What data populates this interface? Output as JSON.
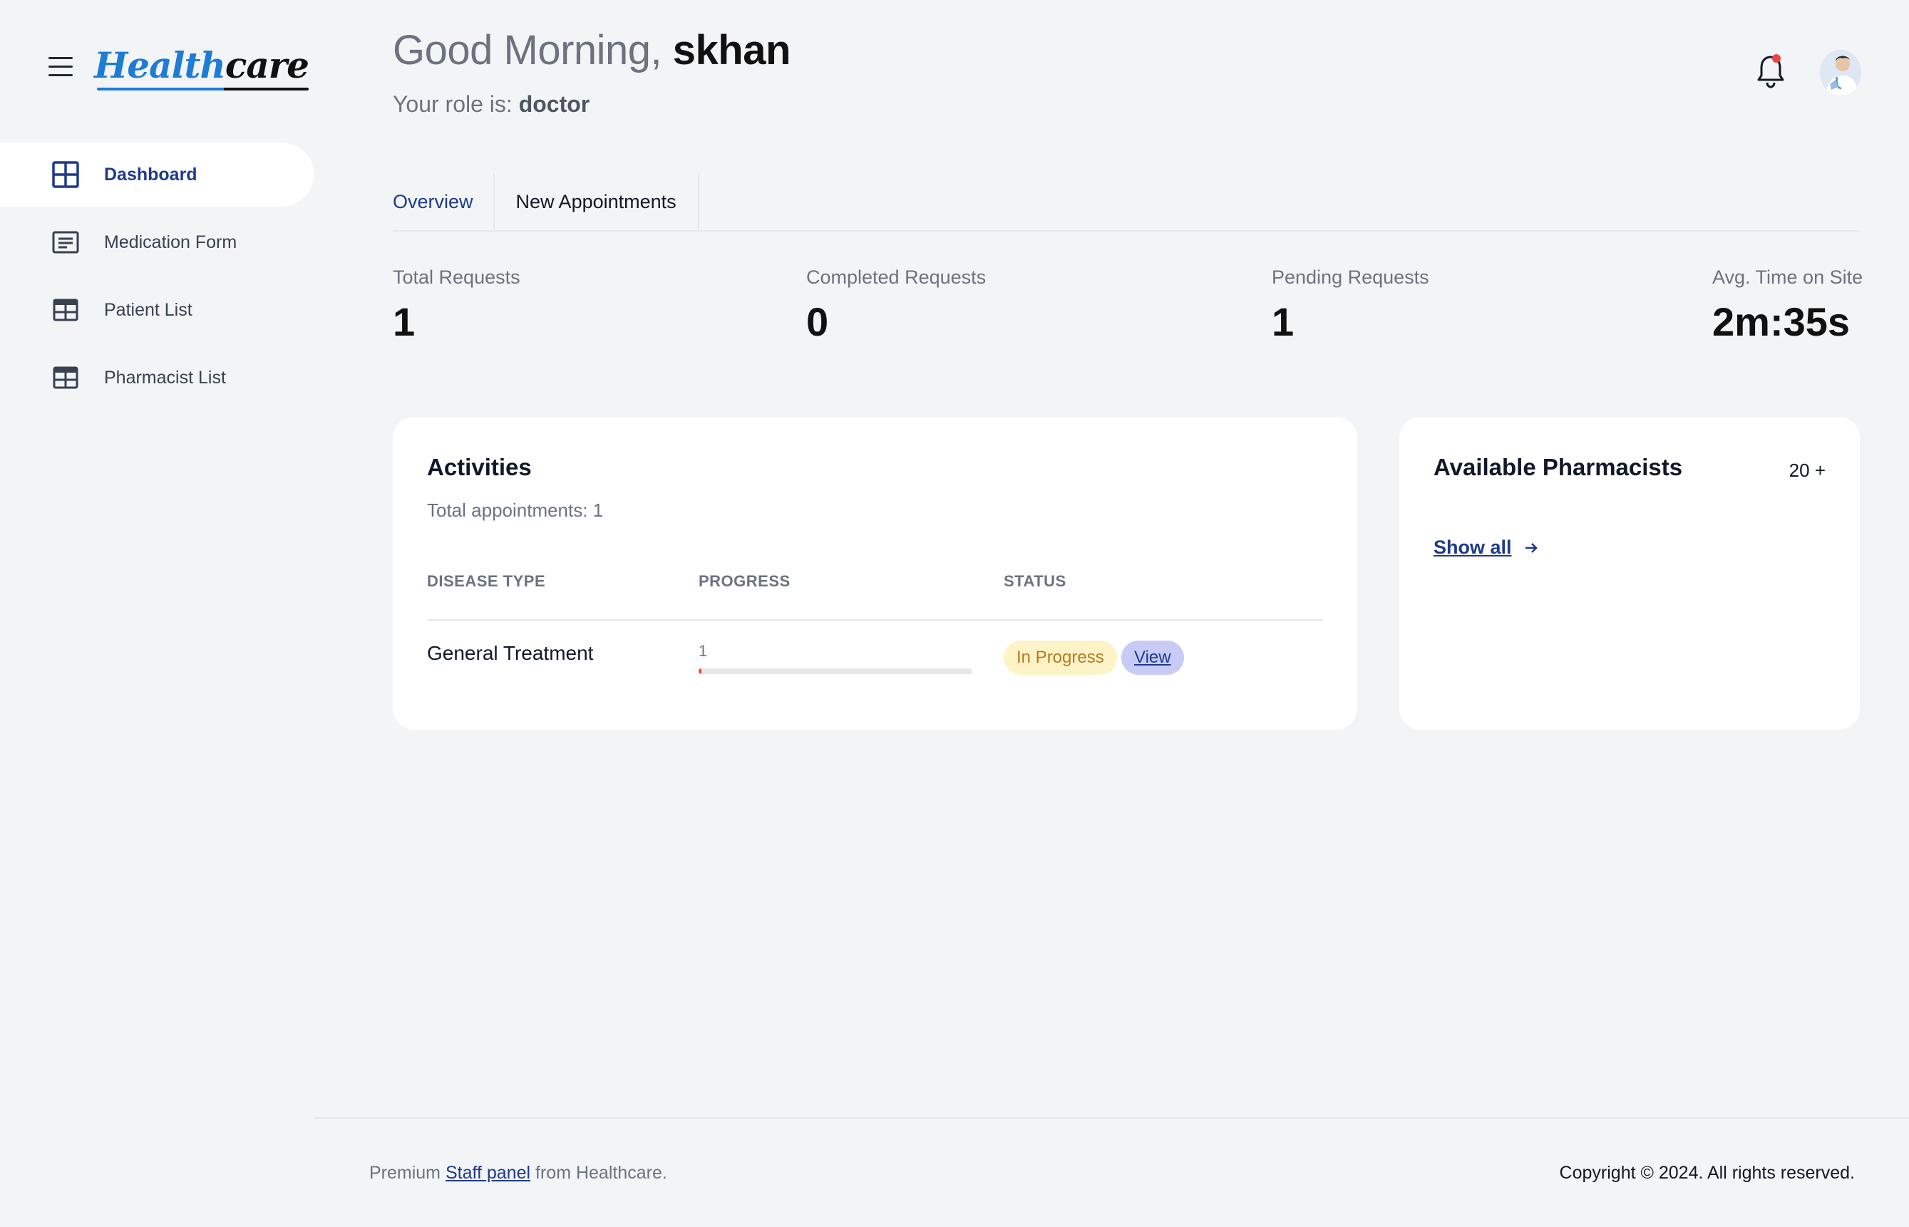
{
  "app": {
    "logo_text_a": "Health",
    "logo_text_b": "care"
  },
  "sidebar": {
    "items": [
      {
        "label": "Dashboard",
        "icon": "dashboard-grid-icon",
        "active": true
      },
      {
        "label": "Medication Form",
        "icon": "form-icon",
        "active": false
      },
      {
        "label": "Patient List",
        "icon": "table-icon",
        "active": false
      },
      {
        "label": "Pharmacist List",
        "icon": "table-icon",
        "active": false
      }
    ]
  },
  "header": {
    "greeting_prefix": "Good Morning,",
    "username": "skhan",
    "role_prefix": "Your role is:",
    "role": "doctor",
    "notification_dot_color": "#ef4444"
  },
  "tabs": [
    {
      "label": "Overview",
      "active": true
    },
    {
      "label": "New Appointments",
      "active": false
    }
  ],
  "stats": [
    {
      "label": "Total Requests",
      "value": "1"
    },
    {
      "label": "Completed Requests",
      "value": "0"
    },
    {
      "label": "Pending Requests",
      "value": "1"
    },
    {
      "label": "Avg. Time on Site",
      "value": "2m:35s"
    }
  ],
  "activities": {
    "title": "Activities",
    "subtitle": "Total appointments: 1",
    "columns": [
      "DISEASE TYPE",
      "PROGRESS",
      "STATUS"
    ],
    "rows": [
      {
        "disease": "General Treatment",
        "progress_label": "1",
        "progress_percent": 1,
        "status": "In Progress",
        "action": "View"
      }
    ]
  },
  "pharmacists": {
    "title": "Available Pharmacists",
    "count": "20 +",
    "show_all": "Show all"
  },
  "footer": {
    "prefix": "Premium",
    "link": "Staff panel",
    "suffix": "from Healthcare.",
    "copyright": "Copyright © 2024. All rights reserved."
  },
  "colors": {
    "accent": "#1e3a8a",
    "background": "#f3f4f6",
    "status_in_progress_bg": "#fef3c7",
    "status_in_progress_text": "#b7791f",
    "progress_fill": "#ef4444"
  }
}
